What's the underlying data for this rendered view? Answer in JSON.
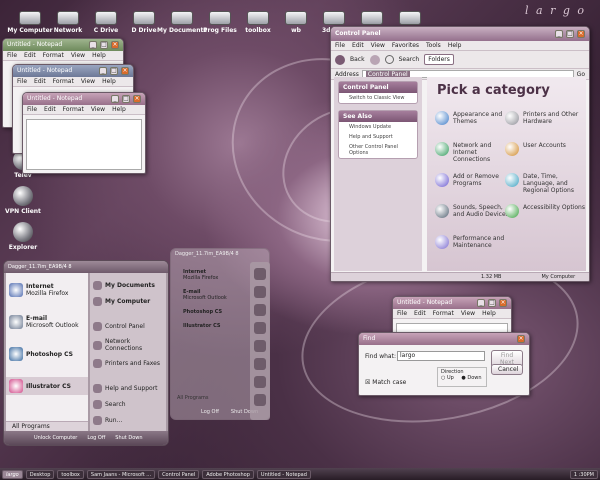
{
  "brand": "l a r g o",
  "desktop_icons_top": [
    "My Computer",
    "Network",
    "C Drive",
    "D Drive",
    "My Documents",
    "Prog Files",
    "toolbox",
    "wb",
    "3ddocs",
    "new utils",
    "xml"
  ],
  "desktop_icons_left": [
    "Telev",
    "VPN Client",
    "Explorer"
  ],
  "notepad1": {
    "title": "Untitled - Notepad",
    "menu": [
      "File",
      "Edit",
      "Format",
      "View",
      "Help"
    ]
  },
  "notepad2": {
    "title": "Untitled - Notepad",
    "menu": [
      "File",
      "Edit",
      "Format",
      "View",
      "Help"
    ]
  },
  "notepad3": {
    "title": "Untitled - Notepad",
    "menu": [
      "File",
      "Edit",
      "Format",
      "View",
      "Help"
    ]
  },
  "notepad4": {
    "title": "Untitled - Notepad",
    "menu": [
      "File",
      "Edit",
      "Format",
      "View",
      "Help"
    ]
  },
  "control_panel": {
    "title": "Control Panel",
    "menu": [
      "File",
      "Edit",
      "View",
      "Favorites",
      "Tools",
      "Help"
    ],
    "toolbar": {
      "back": "Back",
      "search": "Search",
      "folders": "Folders"
    },
    "address_label": "Address",
    "address_value": "Control Panel",
    "go": "Go",
    "side_title": "Control Panel",
    "side_switch": "Switch to Classic View",
    "see_also": "See Also",
    "see_also_items": [
      "Windows Update",
      "Help and Support",
      "Other Control Panel Options"
    ],
    "heading": "Pick a category",
    "categories": [
      "Appearance and Themes",
      "Printers and Other Hardware",
      "Network and Internet Connections",
      "User Accounts",
      "Add or Remove Programs",
      "Date, Time, Language, and Regional Options",
      "Sounds, Speech, and Audio Devices",
      "Accessibility Options",
      "Performance and Maintenance"
    ],
    "status_size": "1.32 MB",
    "status_loc": "My Computer"
  },
  "start_menu": {
    "user": "Dagger_11.7im_EA9B/4 8",
    "pinned": [
      {
        "name": "Internet",
        "sub": "Mozilla Firefox"
      },
      {
        "name": "E-mail",
        "sub": "Microsoft Outlook"
      },
      {
        "name": "Photoshop CS",
        "sub": ""
      },
      {
        "name": "Illustrator CS",
        "sub": ""
      }
    ],
    "all_programs": "All Programs",
    "right": [
      "My Documents",
      "My Computer",
      "Control Panel",
      "Network Connections",
      "Printers and Faxes",
      "Help and Support",
      "Search",
      "Run..."
    ],
    "logoff": "Log Off",
    "shutdown": "Shut Down",
    "unlock": "Unlock Computer"
  },
  "start_menu_ghost": {
    "user": "Dagger_11.7im_EA9B/4 8",
    "items": [
      {
        "name": "Internet",
        "sub": "Mozilla Firefox"
      },
      {
        "name": "E-mail",
        "sub": "Microsoft Outlook"
      },
      {
        "name": "Photoshop CS",
        "sub": ""
      },
      {
        "name": "Illustrator CS",
        "sub": ""
      }
    ],
    "all_programs": "All Programs",
    "logoff": "Log Off",
    "shutdown": "Shut Down"
  },
  "find": {
    "title": "Find",
    "label": "Find what:",
    "value": "largo",
    "find_next": "Find Next",
    "cancel": "Cancel",
    "direction": "Direction",
    "up": "Up",
    "down": "Down",
    "match_case": "Match case"
  },
  "taskbar": {
    "start": "largo",
    "items": [
      "Desktop",
      "toolbox",
      "Sam Jaans - Microsoft ...",
      "Control Panel",
      "Adobe Photoshop",
      "Untitled - Notepad"
    ],
    "clock": "1 :30PM"
  }
}
